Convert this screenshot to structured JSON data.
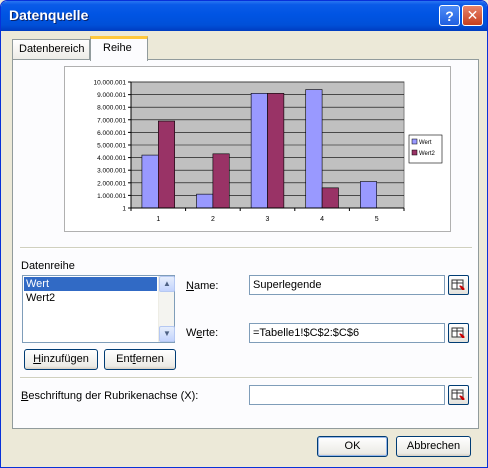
{
  "window": {
    "title": "Datenquelle",
    "help_glyph": "?",
    "close_glyph": "✕"
  },
  "tabs": [
    {
      "label": "Datenbereich",
      "active": false
    },
    {
      "label": "Reihe",
      "active": true
    }
  ],
  "chart_data": {
    "type": "bar",
    "categories": [
      "1",
      "2",
      "3",
      "4",
      "5"
    ],
    "series": [
      {
        "name": "Wert",
        "values": [
          4200000,
          1100000,
          9100000,
          9400000,
          2100000
        ],
        "color": "#9999ff"
      },
      {
        "name": "Wert2",
        "values": [
          6900000,
          4300000,
          9100000,
          1600000,
          null
        ],
        "color": "#993366"
      }
    ],
    "ylim": [
      0,
      10000001
    ],
    "yticks": [
      "10.000.001",
      "9.000.001",
      "8.000.001",
      "7.000.001",
      "6.000.001",
      "5.000.001",
      "4.000.001",
      "3.000.001",
      "2.000.001",
      "1.000.001",
      "1"
    ],
    "grid": true,
    "plot_area_color": "#c0c0c0",
    "legend": "right",
    "xlabel": "",
    "ylabel": ""
  },
  "series_section": {
    "label": "Datenreihe",
    "items": [
      {
        "label": "Wert",
        "selected": true
      },
      {
        "label": "Wert2",
        "selected": false
      }
    ],
    "add_button": {
      "pre": "",
      "key": "H",
      "post": "inzufügen"
    },
    "remove_button": {
      "pre": "Ent",
      "key": "f",
      "post": "ernen"
    }
  },
  "name_field": {
    "pre": "",
    "key": "N",
    "post": "ame:",
    "value": "Superlegende"
  },
  "values_field": {
    "pre": "W",
    "key": "e",
    "post": "rte:",
    "value": "=Tabelle1!$C$2:$C$6"
  },
  "category_field": {
    "pre": "",
    "key": "B",
    "post": "eschriftung der Rubrikenachse (X):",
    "value": ""
  },
  "footer": {
    "ok": "OK",
    "cancel": "Abbrechen"
  }
}
